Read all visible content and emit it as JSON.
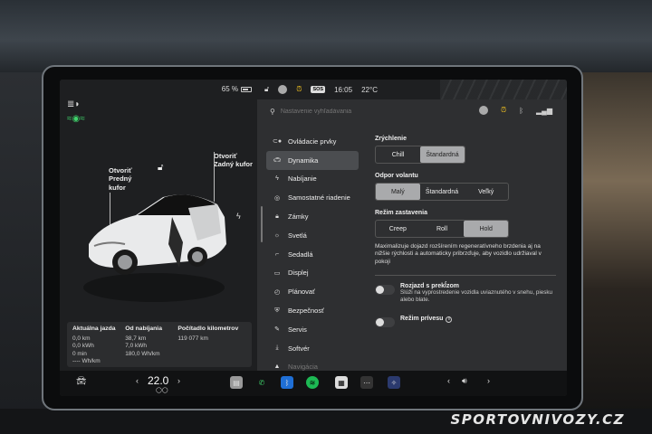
{
  "status": {
    "battery": "65 %",
    "time": "16:05",
    "temperature": "22°C",
    "sos_badge": "SOS"
  },
  "car_panel": {
    "callout_front_trunk": "Otvoriť\nPredný\nkufor",
    "callout_rear_trunk": "Otvoriť\nZadný kufor",
    "stats": [
      {
        "header": "Aktuálna jazda",
        "lines": [
          "0,0 km",
          "0,0 kWh",
          "0 min",
          "---- Wh/km"
        ]
      },
      {
        "header": "Od nabíjania",
        "lines": [
          "38,7 km",
          "7,0 kWh",
          "180,0 Wh/km"
        ]
      },
      {
        "header": "Počítadlo kilometrov",
        "lines": [
          "119 077 km"
        ]
      }
    ]
  },
  "search": {
    "placeholder": "Nastavenie vyhľadávania"
  },
  "menu": {
    "items": [
      {
        "label": "Ovládacie prvky",
        "icon": "toggle-icon"
      },
      {
        "label": "Dynamika",
        "icon": "car-icon"
      },
      {
        "label": "Nabíjanie",
        "icon": "bolt-icon"
      },
      {
        "label": "Samostatné riadenie",
        "icon": "steering-wheel-icon"
      },
      {
        "label": "Zámky",
        "icon": "lock-icon"
      },
      {
        "label": "Svetlá",
        "icon": "sun-icon"
      },
      {
        "label": "Sedadlá",
        "icon": "seat-icon"
      },
      {
        "label": "Displej",
        "icon": "display-icon"
      },
      {
        "label": "Plánovať",
        "icon": "clock-icon"
      },
      {
        "label": "Bezpečnosť",
        "icon": "shield-icon"
      },
      {
        "label": "Servis",
        "icon": "wrench-icon"
      },
      {
        "label": "Softvér",
        "icon": "download-icon"
      },
      {
        "label": "Navigácia",
        "icon": "navigation-icon"
      }
    ],
    "active_index": 1
  },
  "dynamics": {
    "acceleration": {
      "title": "Zrýchlenie",
      "options": [
        "Chill",
        "Štandardná"
      ],
      "selected": 1
    },
    "steering": {
      "title": "Odpor volantu",
      "options": [
        "Malý",
        "Štandardná",
        "Veľký"
      ],
      "selected": 0
    },
    "stopping": {
      "title": "Režim zastavenia",
      "options": [
        "Creep",
        "Roll",
        "Hold"
      ],
      "selected": 2
    },
    "stopping_desc": "Maximalizuje dojazd rozšírením regeneratívneho brzdenia aj na nižšie rýchlosti a automaticky pribrzďuje, aby vozidlo udržiaval v pokoji",
    "rocking": {
      "title": "Rozjazd s prekĺzom",
      "desc": "Slúži na vyprostredenie vozidla uviaznutého v snehu, piesku alebo blate."
    },
    "trailer": {
      "title": "Režim prívesu"
    }
  },
  "dock": {
    "temperature": "22.0",
    "temp_left_arrow": "‹",
    "temp_right_arrow": "›"
  },
  "watermark": "SPORTOVNIVOZY.CZ"
}
